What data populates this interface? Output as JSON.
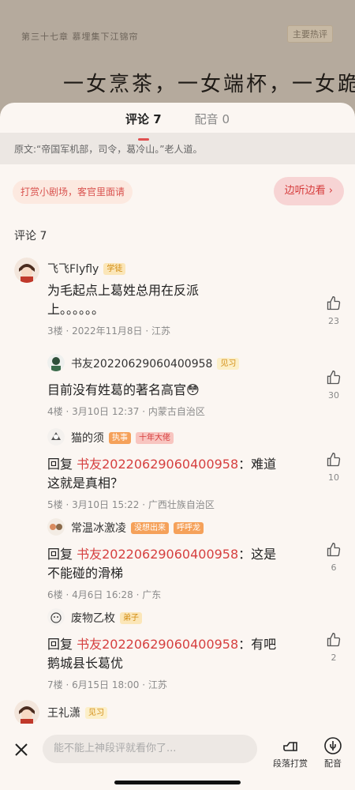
{
  "book": {
    "chapter": "第三十七章 慕埋集下江锦帘",
    "action_btn": "主要热评",
    "line1": "一女烹茶，一女端杯，一女跪在",
    "line2": "……"
  },
  "tabs": [
    {
      "label": "评论 7",
      "active": true
    },
    {
      "label": "配音 0",
      "active": false
    }
  ],
  "original_text": "原文:“帝国军机部，司令，葛冷山。”老人道。",
  "reward_chip": "打赏小剧场，客官里面请",
  "listen_btn": "边听边看",
  "comments_header": "评论 7",
  "comments": [
    {
      "user": "飞飞Flyfly",
      "badges": [
        "学徒"
      ],
      "text": "为毛起点上葛姓总用在反派上。。。。。。",
      "floor": "3楼",
      "date": "2022年11月8日",
      "region": "江苏",
      "likes": "23"
    },
    {
      "user": "书友20220629060400958",
      "badges": [
        "见习"
      ],
      "text": "目前没有姓葛的著名高官😳",
      "floor": "4楼",
      "date": "3月10日 12:37",
      "region": "内蒙古自治区",
      "likes": "30"
    },
    {
      "user": "猫的须",
      "badges": [
        "执事",
        "十年大佬"
      ],
      "reply_prefix": "回复",
      "mention": "书友20220629060400958",
      "text": "：难道这就是真相？",
      "floor": "5楼",
      "date": "3月10日 15:22",
      "region": "广西壮族自治区",
      "likes": "10"
    },
    {
      "user": "常温冰激凌",
      "badges": [
        "没想出来",
        "呼呼龙"
      ],
      "reply_prefix": "回复",
      "mention": "书友20220629060400958",
      "text": "：这是不能碰的滑梯",
      "floor": "6楼",
      "date": "4月6日 16:28",
      "region": "广东",
      "likes": "6"
    },
    {
      "user": "废物乙枚",
      "badges": [
        "弟子"
      ],
      "reply_prefix": "回复",
      "mention": "书友20220629060400958",
      "text": "：有吧 鹅城县长葛优",
      "floor": "7楼",
      "date": "6月15日 18:00",
      "region": "江苏",
      "likes": "2"
    },
    {
      "user": "王礼潇",
      "badges": [
        "见习"
      ]
    }
  ],
  "input_placeholder": "能不能上神段评就看你了...",
  "tools": {
    "reward": "段落打赏",
    "dub": "配音"
  },
  "colors": {
    "accent": "#e05050",
    "badge_yellow": "#fbe6b8",
    "badge_orange": "#f5a15a"
  }
}
